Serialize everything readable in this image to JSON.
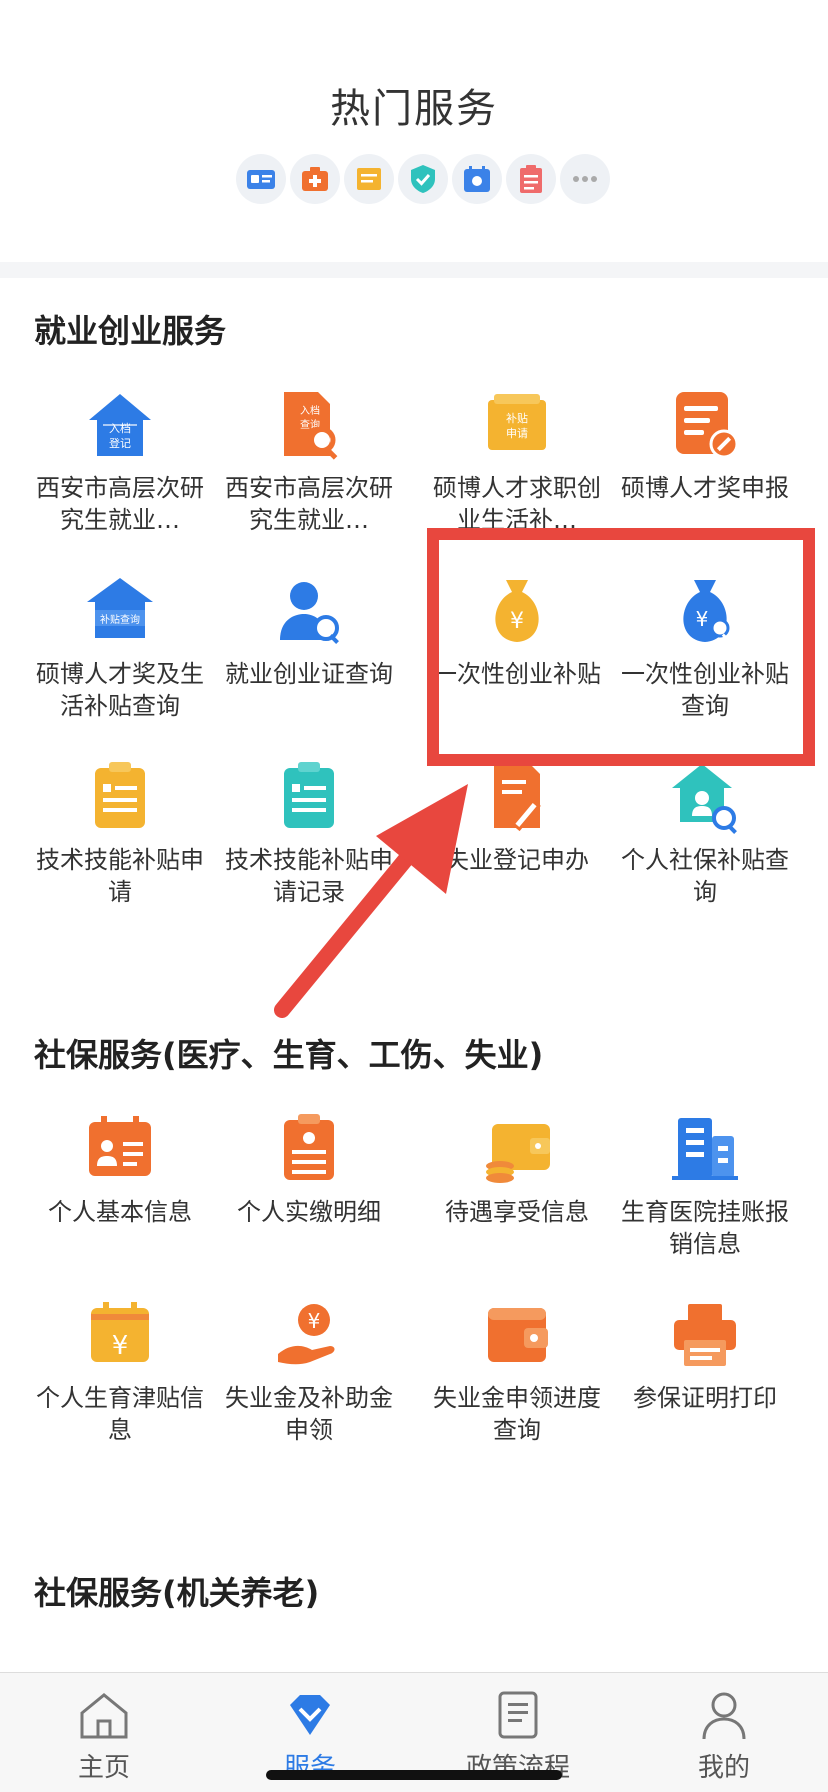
{
  "hot": {
    "title": "热门服务",
    "icons": [
      "id-card-icon",
      "medical-kit-icon",
      "document-icon",
      "shield-check-icon",
      "calendar-icon",
      "clipboard-icon",
      "more-icon"
    ]
  },
  "sections": [
    {
      "title": "就业创业服务",
      "items": [
        {
          "label": "西安市高层次研究生就业…",
          "icon": "house-register-icon"
        },
        {
          "label": "西安市高层次研究生就业…",
          "icon": "document-search-icon"
        },
        {
          "label": "硕博人才求职创业生活补…",
          "icon": "ticket-subsidy-icon"
        },
        {
          "label": "硕博人才奖申报",
          "icon": "form-edit-icon"
        },
        {
          "label": "硕博人才奖及生活补贴查询",
          "icon": "subsidy-query-house-icon"
        },
        {
          "label": "就业创业证查询",
          "icon": "user-search-icon"
        },
        {
          "label": "一次性创业补贴",
          "icon": "money-bag-icon"
        },
        {
          "label": "一次性创业补贴查询",
          "icon": "money-bag-search-icon"
        },
        {
          "label": "技术技能补贴申请",
          "icon": "clipboard-yellow-icon"
        },
        {
          "label": "技术技能补贴申请记录",
          "icon": "clipboard-teal-icon"
        },
        {
          "label": "失业登记申办",
          "icon": "document-pen-icon"
        },
        {
          "label": "个人社保补贴查询",
          "icon": "house-search-icon"
        }
      ]
    },
    {
      "title": "社保服务(医疗、生育、工伤、失业)",
      "items": [
        {
          "label": "个人基本信息",
          "icon": "personal-calendar-icon"
        },
        {
          "label": "个人实缴明细",
          "icon": "clipboard-list-icon"
        },
        {
          "label": "待遇享受信息",
          "icon": "wallet-coins-icon"
        },
        {
          "label": "生育医院挂账报销信息",
          "icon": "building-icon"
        },
        {
          "label": "个人生育津贴信息",
          "icon": "calendar-yen-icon"
        },
        {
          "label": "失业金及补助金申领",
          "icon": "hand-yen-icon"
        },
        {
          "label": "失业金申领进度查询",
          "icon": "wallet-icon"
        },
        {
          "label": "参保证明打印",
          "icon": "printer-icon"
        }
      ]
    },
    {
      "title": "社保服务(机关养老)",
      "items": []
    }
  ],
  "tabs": [
    {
      "label": "主页",
      "icon": "home-icon",
      "active": false
    },
    {
      "label": "服务",
      "icon": "service-diamond-icon",
      "active": true
    },
    {
      "label": "政策流程",
      "icon": "policy-document-icon",
      "active": false
    },
    {
      "label": "我的",
      "icon": "user-icon",
      "active": false
    }
  ],
  "colors": {
    "accent": "#2d7be5",
    "highlight": "#e8473e",
    "orange": "#f08a3a",
    "yellow": "#f4b330",
    "teal": "#2fc2bd"
  }
}
